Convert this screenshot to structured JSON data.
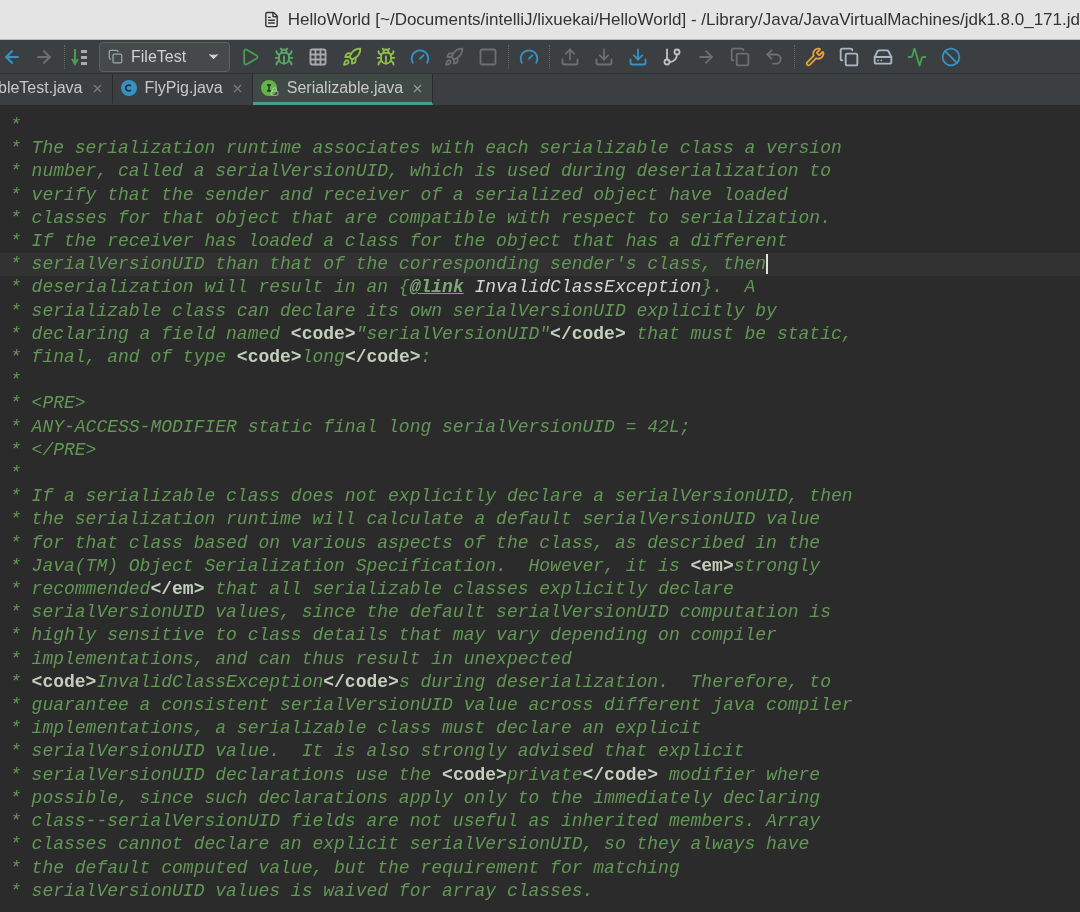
{
  "window": {
    "title": "HelloWorld [~/Documents/intelliJ/lixuekai/HelloWorld] - /Library/Java/JavaVirtualMachines/jdk1.8.0_171.jd"
  },
  "toolbar": {
    "run_config": "FileTest"
  },
  "tabs": [
    {
      "label": "bleTest.java",
      "kind": "plain",
      "selected": false
    },
    {
      "label": "FlyPig.java",
      "kind": "class",
      "selected": false
    },
    {
      "label": "Serializable.java",
      "kind": "interface",
      "selected": true
    }
  ],
  "editor": {
    "lines": [
      {
        "current": false,
        "segments": [
          {
            "kind": "comment",
            "text": "*"
          }
        ]
      },
      {
        "current": false,
        "segments": [
          {
            "kind": "comment",
            "text": "* The serialization runtime associates with each serializable class a version"
          }
        ]
      },
      {
        "current": false,
        "segments": [
          {
            "kind": "comment",
            "text": "* number, called a serialVersionUID, which is used during deserialization to"
          }
        ]
      },
      {
        "current": false,
        "segments": [
          {
            "kind": "comment",
            "text": "* verify that the sender and receiver of a serialized object have loaded"
          }
        ]
      },
      {
        "current": false,
        "segments": [
          {
            "kind": "comment",
            "text": "* classes for that object that are compatible with respect to serialization."
          }
        ]
      },
      {
        "current": false,
        "segments": [
          {
            "kind": "comment",
            "text": "* If the receiver has loaded a class for the object that has a different"
          }
        ]
      },
      {
        "current": true,
        "segments": [
          {
            "kind": "comment",
            "text": "* serialVersionUID than that of the corresponding sender's class, then"
          }
        ]
      },
      {
        "current": false,
        "segments": [
          {
            "kind": "comment",
            "text": "* deserialization will result in an {"
          },
          {
            "kind": "link",
            "text": "@link"
          },
          {
            "kind": "ref",
            "text": " InvalidClassException"
          },
          {
            "kind": "comment",
            "text": "}.  A"
          }
        ]
      },
      {
        "current": false,
        "segments": [
          {
            "kind": "comment",
            "text": "* serializable class can declare its own serialVersionUID explicitly by"
          }
        ]
      },
      {
        "current": false,
        "segments": [
          {
            "kind": "comment",
            "text": "* declaring a field named "
          },
          {
            "kind": "tag",
            "text": "<code>"
          },
          {
            "kind": "comment",
            "text": "\"serialVersionUID\""
          },
          {
            "kind": "tag",
            "text": "</code>"
          },
          {
            "kind": "comment",
            "text": " that must be static,"
          }
        ]
      },
      {
        "current": false,
        "segments": [
          {
            "kind": "comment",
            "text": "* final, and of type "
          },
          {
            "kind": "tag",
            "text": "<code>"
          },
          {
            "kind": "comment",
            "text": "long"
          },
          {
            "kind": "tag",
            "text": "</code>"
          },
          {
            "kind": "comment",
            "text": ":"
          }
        ]
      },
      {
        "current": false,
        "segments": [
          {
            "kind": "comment",
            "text": "*"
          }
        ]
      },
      {
        "current": false,
        "segments": [
          {
            "kind": "comment",
            "text": "* <PRE>"
          }
        ]
      },
      {
        "current": false,
        "segments": [
          {
            "kind": "comment",
            "text": "* ANY-ACCESS-MODIFIER static final long serialVersionUID = 42L;"
          }
        ]
      },
      {
        "current": false,
        "segments": [
          {
            "kind": "comment",
            "text": "* </PRE>"
          }
        ]
      },
      {
        "current": false,
        "segments": [
          {
            "kind": "comment",
            "text": "*"
          }
        ]
      },
      {
        "current": false,
        "segments": [
          {
            "kind": "comment",
            "text": "* If a serializable class does not explicitly declare a serialVersionUID, then"
          }
        ]
      },
      {
        "current": false,
        "segments": [
          {
            "kind": "comment",
            "text": "* the serialization runtime will calculate a default serialVersionUID value"
          }
        ]
      },
      {
        "current": false,
        "segments": [
          {
            "kind": "comment",
            "text": "* for that class based on various aspects of the class, as described in the"
          }
        ]
      },
      {
        "current": false,
        "segments": [
          {
            "kind": "comment",
            "text": "* Java(TM) Object Serialization Specification.  However, it is "
          },
          {
            "kind": "tag",
            "text": "<em>"
          },
          {
            "kind": "comment",
            "text": "strongly"
          }
        ]
      },
      {
        "current": false,
        "segments": [
          {
            "kind": "comment",
            "text": "* recommended"
          },
          {
            "kind": "tag",
            "text": "</em>"
          },
          {
            "kind": "comment",
            "text": " that all serializable classes explicitly declare"
          }
        ]
      },
      {
        "current": false,
        "segments": [
          {
            "kind": "comment",
            "text": "* serialVersionUID values, since the default serialVersionUID computation is"
          }
        ]
      },
      {
        "current": false,
        "segments": [
          {
            "kind": "comment",
            "text": "* highly sensitive to class details that may vary depending on compiler"
          }
        ]
      },
      {
        "current": false,
        "segments": [
          {
            "kind": "comment",
            "text": "* implementations, and can thus result in unexpected"
          }
        ]
      },
      {
        "current": false,
        "segments": [
          {
            "kind": "comment",
            "text": "* "
          },
          {
            "kind": "tag",
            "text": "<code>"
          },
          {
            "kind": "comment",
            "text": "InvalidClassException"
          },
          {
            "kind": "tag",
            "text": "</code>"
          },
          {
            "kind": "comment",
            "text": "s during deserialization.  Therefore, to"
          }
        ]
      },
      {
        "current": false,
        "segments": [
          {
            "kind": "comment",
            "text": "* guarantee a consistent serialVersionUID value across different java compiler"
          }
        ]
      },
      {
        "current": false,
        "segments": [
          {
            "kind": "comment",
            "text": "* implementations, a serializable class must declare an explicit"
          }
        ]
      },
      {
        "current": false,
        "segments": [
          {
            "kind": "comment",
            "text": "* serialVersionUID value.  It is also strongly advised that explicit"
          }
        ]
      },
      {
        "current": false,
        "segments": [
          {
            "kind": "comment",
            "text": "* serialVersionUID declarations use the "
          },
          {
            "kind": "tag",
            "text": "<code>"
          },
          {
            "kind": "comment",
            "text": "private"
          },
          {
            "kind": "tag",
            "text": "</code>"
          },
          {
            "kind": "comment",
            "text": " modifier where"
          }
        ]
      },
      {
        "current": false,
        "segments": [
          {
            "kind": "comment",
            "text": "* possible, since such declarations apply only to the immediately declaring"
          }
        ]
      },
      {
        "current": false,
        "segments": [
          {
            "kind": "comment",
            "text": "* class--serialVersionUID fields are not useful as inherited members. Array"
          }
        ]
      },
      {
        "current": false,
        "segments": [
          {
            "kind": "comment",
            "text": "* classes cannot declare an explicit serialVersionUID, so they always have"
          }
        ]
      },
      {
        "current": false,
        "segments": [
          {
            "kind": "comment",
            "text": "* the default computed value, but the requirement for matching"
          }
        ]
      },
      {
        "current": false,
        "segments": [
          {
            "kind": "comment",
            "text": "* serialVersionUID values is waived for array classes."
          }
        ]
      }
    ]
  }
}
